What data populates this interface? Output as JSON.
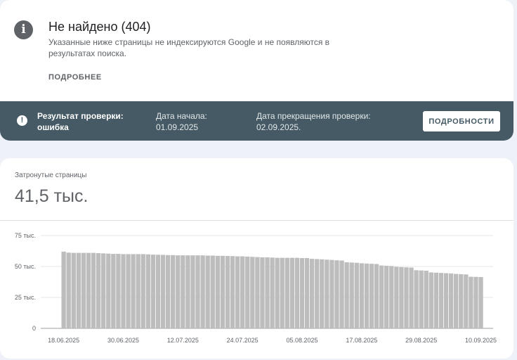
{
  "issue": {
    "icon": "info-icon",
    "title": "Не найдено (404)",
    "description": "Указанные ниже страницы не индексируются Google и не появляются в результатах поиска.",
    "more_link": "ПОДРОБНЕЕ"
  },
  "status": {
    "icon": "exclamation-icon",
    "result_label": "Результат проверки: ошибка",
    "start_label": "Дата начала: 01.09.2025",
    "end_label": "Дата прекращения проверки: 02.09.2025.",
    "details_button": "ПОДРОБНОСТИ"
  },
  "metric": {
    "label": "Затронутые страницы",
    "value": "41,5 тыс."
  },
  "colors": {
    "status_bar": "#455a64",
    "bars": "#bdbdbd"
  },
  "chart_data": {
    "type": "bar",
    "y_ticks": [
      "0",
      "25 тыс.",
      "50 тыс.",
      "75 тыс."
    ],
    "y_tick_values": [
      0,
      25000,
      50000,
      75000
    ],
    "ylim": [
      0,
      75000
    ],
    "x_ticks": [
      "18.06.2025",
      "30.06.2025",
      "12.07.2025",
      "24.07.2025",
      "05.08.2025",
      "17.08.2025",
      "29.08.2025",
      "10.09.2025"
    ],
    "x_tick_indices": [
      0,
      12,
      24,
      36,
      48,
      60,
      72,
      84
    ],
    "grid": true,
    "values": [
      62000,
      61200,
      61000,
      61000,
      61000,
      61000,
      61000,
      60800,
      60600,
      60400,
      60200,
      60200,
      60000,
      60000,
      60000,
      60000,
      60000,
      59800,
      59600,
      59500,
      59400,
      59200,
      59200,
      59000,
      59000,
      59000,
      59000,
      59000,
      59000,
      58800,
      58800,
      58600,
      58600,
      58500,
      58400,
      58200,
      58200,
      58000,
      57800,
      57600,
      57400,
      57400,
      57200,
      57000,
      57000,
      57000,
      57000,
      57000,
      56800,
      56800,
      56200,
      56000,
      55800,
      55500,
      55300,
      55000,
      54800,
      53400,
      53200,
      53000,
      52600,
      52400,
      52200,
      52000,
      50800,
      50600,
      50400,
      49700,
      49500,
      49300,
      49100,
      47000,
      46800,
      46600,
      45200,
      45000,
      44800,
      44600,
      44400,
      44000,
      43800,
      43600,
      41700,
      41600,
      41500
    ]
  }
}
